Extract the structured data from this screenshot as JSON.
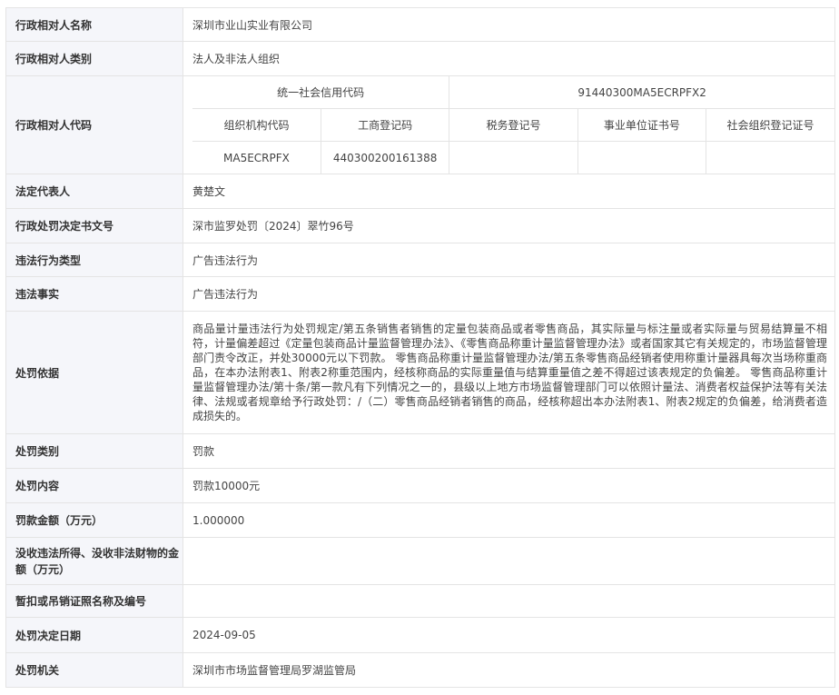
{
  "rows": {
    "party_name": {
      "label": "行政相对人名称",
      "value": "深圳市业山实业有限公司"
    },
    "party_type": {
      "label": "行政相对人类别",
      "value": "法人及非法人组织"
    },
    "party_code": {
      "label": "行政相对人代码",
      "credit_code_label": "统一社会信用代码",
      "credit_code_value": "91440300MA5ECRPFX2",
      "headers": [
        "组织机构代码",
        "工商登记码",
        "税务登记号",
        "事业单位证书号",
        "社会组织登记证号"
      ],
      "values": [
        "MA5ECRPFX",
        "440300200161388",
        "",
        "",
        ""
      ]
    },
    "legal_rep": {
      "label": "法定代表人",
      "value": "黄楚文"
    },
    "doc_number": {
      "label": "行政处罚决定书文号",
      "value": "深市监罗处罚〔2024〕翠竹96号"
    },
    "violation_type": {
      "label": "违法行为类型",
      "value": "广告违法行为"
    },
    "violation_facts": {
      "label": "违法事实",
      "value": "广告违法行为"
    },
    "penalty_basis": {
      "label": "处罚依据",
      "value": "商品量计量违法行为处罚规定/第五条销售者销售的定量包装商品或者零售商品，其实际量与标注量或者实际量与贸易结算量不相符，计量偏差超过《定量包装商品计量监督管理办法》、《零售商品称重计量监督管理办法》或者国家其它有关规定的，市场监督管理部门责令改正，并处30000元以下罚款。 零售商品称重计量监督管理办法/第五条零售商品经销者使用称重计量器具每次当场称重商品，在本办法附表1、附表2称重范围内，经核称商品的实际重量值与结算重量值之差不得超过该表规定的负偏差。 零售商品称重计量监督管理办法/第十条/第一款凡有下列情况之一的，县级以上地方市场监督管理部门可以依照计量法、消费者权益保护法等有关法律、法规或者规章给予行政处罚：/（二）零售商品经销者销售的商品，经核称超出本办法附表1、附表2规定的负偏差，给消费者造成损失的。"
    },
    "penalty_category": {
      "label": "处罚类别",
      "value": "罚款"
    },
    "penalty_content": {
      "label": "处罚内容",
      "value": "罚款10000元"
    },
    "fine_amount": {
      "label": "罚款金额（万元）",
      "value": "1.000000"
    },
    "confiscated_amount": {
      "label": "没收违法所得、没收非法财物的金额（万元）",
      "value": ""
    },
    "license_revoked": {
      "label": "暂扣或吊销证照名称及编号",
      "value": ""
    },
    "decision_date": {
      "label": "处罚决定日期",
      "value": "2024-09-05"
    },
    "authority": {
      "label": "处罚机关",
      "value": "深圳市市场监督管理局罗湖监管局"
    }
  }
}
